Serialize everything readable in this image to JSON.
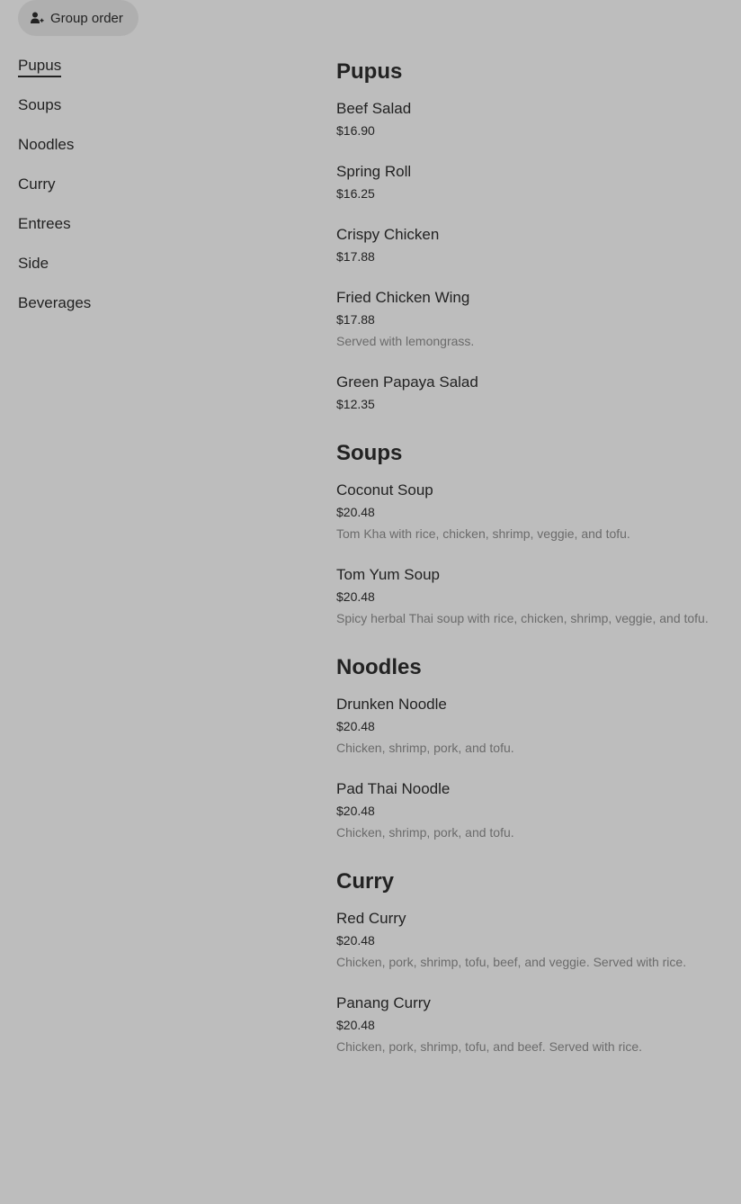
{
  "group_order": {
    "label": "Group order",
    "icon": "person-add-icon"
  },
  "nav": {
    "items": [
      {
        "label": "Pupus",
        "active": true
      },
      {
        "label": "Soups"
      },
      {
        "label": "Noodles"
      },
      {
        "label": "Curry"
      },
      {
        "label": "Entrees"
      },
      {
        "label": "Side"
      },
      {
        "label": "Beverages"
      }
    ]
  },
  "menu": {
    "sections": [
      {
        "title": "Pupus",
        "items": [
          {
            "name": "Beef Salad",
            "price": "$16.90"
          },
          {
            "name": "Spring Roll",
            "price": "$16.25"
          },
          {
            "name": "Crispy Chicken",
            "price": "$17.88"
          },
          {
            "name": "Fried Chicken Wing",
            "price": "$17.88",
            "desc": "Served with lemongrass."
          },
          {
            "name": "Green Papaya Salad",
            "price": "$12.35"
          }
        ]
      },
      {
        "title": "Soups",
        "items": [
          {
            "name": "Coconut Soup",
            "price": "$20.48",
            "desc": "Tom Kha with rice, chicken, shrimp, veggie, and tofu."
          },
          {
            "name": "Tom Yum Soup",
            "price": "$20.48",
            "desc": "Spicy herbal Thai soup with rice, chicken, shrimp, veggie, and tofu."
          }
        ]
      },
      {
        "title": "Noodles",
        "items": [
          {
            "name": "Drunken Noodle",
            "price": "$20.48",
            "desc": "Chicken, shrimp, pork, and tofu."
          },
          {
            "name": "Pad Thai Noodle",
            "price": "$20.48",
            "desc": "Chicken, shrimp, pork, and tofu."
          }
        ]
      },
      {
        "title": "Curry",
        "items": [
          {
            "name": "Red Curry",
            "price": "$20.48",
            "desc": "Chicken, pork, shrimp, tofu, beef, and veggie. Served with rice."
          },
          {
            "name": "Panang Curry",
            "price": "$20.48",
            "desc": "Chicken, pork, shrimp, tofu, and beef. Served with rice."
          }
        ]
      }
    ]
  }
}
